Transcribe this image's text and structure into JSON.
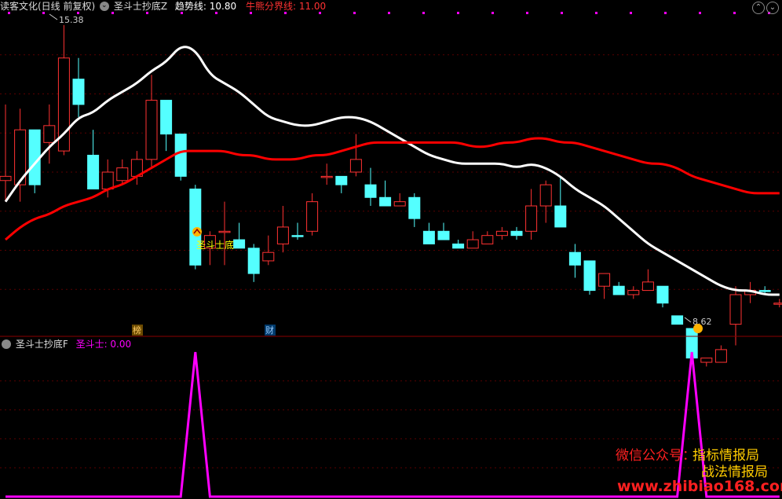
{
  "header": {
    "stock_name": "读客文化(日线 前复权)",
    "indicator_name": "圣斗士抄底Z",
    "trend_label": "趋势线: ",
    "trend_value": "10.80",
    "bull_bear_label": "牛熊分界线: ",
    "bull_bear_value": "11.00",
    "collapse_icon": "chevron-down-circle-icon"
  },
  "sub_header": {
    "indicator_name": "圣斗士抄底F",
    "value_label": "圣斗士: ",
    "value": "0.00"
  },
  "annotations": {
    "high_label": "15.38",
    "low_label": "8.62",
    "signal_label": "圣斗士底",
    "badge_bang": "榜",
    "badge_cai": "财"
  },
  "watermark": {
    "line1": "微信公众号：",
    "line1b": "指标情报局",
    "line2": "战法情报局",
    "line3": "www.zhibiao168.com"
  },
  "colors": {
    "up": "#ff3232",
    "down": "#54ffff",
    "trend": "#ffffff",
    "bullbear": "#ff0000",
    "signal": "#ff00ff",
    "label_yellow": "#ffff00"
  },
  "chart_data": {
    "type": "candlestick",
    "price_ylim": [
      8.2,
      15.6
    ],
    "candles": [
      {
        "o": 11.8,
        "h": 13.5,
        "l": 11.2,
        "c": 11.7,
        "d": "u"
      },
      {
        "o": 11.6,
        "h": 13.4,
        "l": 11.2,
        "c": 12.9,
        "d": "u"
      },
      {
        "o": 12.9,
        "h": 12.9,
        "l": 11.4,
        "c": 11.6,
        "d": "d"
      },
      {
        "o": 13.0,
        "h": 13.5,
        "l": 12.1,
        "c": 12.6,
        "d": "u"
      },
      {
        "o": 12.4,
        "h": 15.38,
        "l": 12.3,
        "c": 14.6,
        "d": "u"
      },
      {
        "o": 14.1,
        "h": 14.6,
        "l": 13.2,
        "c": 13.5,
        "d": "d"
      },
      {
        "o": 12.3,
        "h": 12.9,
        "l": 11.5,
        "c": 11.5,
        "d": "d"
      },
      {
        "o": 11.5,
        "h": 12.2,
        "l": 11.3,
        "c": 11.9,
        "d": "u"
      },
      {
        "o": 11.7,
        "h": 12.2,
        "l": 11.6,
        "c": 12.0,
        "d": "u"
      },
      {
        "o": 11.8,
        "h": 12.4,
        "l": 11.6,
        "c": 12.2,
        "d": "u"
      },
      {
        "o": 12.2,
        "h": 14.2,
        "l": 12.0,
        "c": 13.6,
        "d": "u"
      },
      {
        "o": 13.6,
        "h": 13.4,
        "l": 12.4,
        "c": 12.8,
        "d": "d"
      },
      {
        "o": 12.8,
        "h": 12.7,
        "l": 11.7,
        "c": 11.8,
        "d": "d"
      },
      {
        "o": 11.5,
        "h": 11.6,
        "l": 9.6,
        "c": 9.7,
        "d": "d"
      },
      {
        "o": 10.1,
        "h": 10.5,
        "l": 9.7,
        "c": 10.4,
        "d": "u"
      },
      {
        "o": 10.5,
        "h": 11.2,
        "l": 9.7,
        "c": 10.5,
        "d": "u"
      },
      {
        "o": 10.3,
        "h": 10.7,
        "l": 10.1,
        "c": 10.1,
        "d": "d"
      },
      {
        "o": 10.1,
        "h": 10.2,
        "l": 9.3,
        "c": 9.5,
        "d": "d"
      },
      {
        "o": 9.8,
        "h": 10.4,
        "l": 9.7,
        "c": 10.0,
        "d": "u"
      },
      {
        "o": 10.2,
        "h": 11.1,
        "l": 10.0,
        "c": 10.6,
        "d": "u"
      },
      {
        "o": 10.4,
        "h": 10.7,
        "l": 10.3,
        "c": 10.4,
        "d": "d"
      },
      {
        "o": 10.5,
        "h": 11.4,
        "l": 10.4,
        "c": 11.2,
        "d": "u"
      },
      {
        "o": 11.8,
        "h": 12.1,
        "l": 11.6,
        "c": 11.8,
        "d": "u"
      },
      {
        "o": 11.8,
        "h": 11.6,
        "l": 11.4,
        "c": 11.6,
        "d": "d"
      },
      {
        "o": 11.9,
        "h": 12.8,
        "l": 11.8,
        "c": 12.2,
        "d": "u"
      },
      {
        "o": 11.6,
        "h": 12.0,
        "l": 11.1,
        "c": 11.3,
        "d": "d"
      },
      {
        "o": 11.3,
        "h": 11.7,
        "l": 11.1,
        "c": 11.1,
        "d": "d"
      },
      {
        "o": 11.1,
        "h": 11.4,
        "l": 11.1,
        "c": 11.2,
        "d": "u"
      },
      {
        "o": 11.3,
        "h": 11.4,
        "l": 10.6,
        "c": 10.8,
        "d": "d"
      },
      {
        "o": 10.5,
        "h": 10.7,
        "l": 10.2,
        "c": 10.2,
        "d": "d"
      },
      {
        "o": 10.5,
        "h": 10.7,
        "l": 10.3,
        "c": 10.3,
        "d": "d"
      },
      {
        "o": 10.2,
        "h": 10.3,
        "l": 10.1,
        "c": 10.1,
        "d": "d"
      },
      {
        "o": 10.1,
        "h": 10.5,
        "l": 10.1,
        "c": 10.3,
        "d": "u"
      },
      {
        "o": 10.2,
        "h": 10.5,
        "l": 10.2,
        "c": 10.4,
        "d": "u"
      },
      {
        "o": 10.4,
        "h": 10.6,
        "l": 10.3,
        "c": 10.5,
        "d": "u"
      },
      {
        "o": 10.5,
        "h": 10.6,
        "l": 10.3,
        "c": 10.4,
        "d": "d"
      },
      {
        "o": 10.5,
        "h": 11.5,
        "l": 10.3,
        "c": 11.1,
        "d": "u"
      },
      {
        "o": 11.1,
        "h": 11.7,
        "l": 10.7,
        "c": 11.6,
        "d": "u"
      },
      {
        "o": 11.1,
        "h": 11.8,
        "l": 10.6,
        "c": 10.6,
        "d": "d"
      },
      {
        "o": 10.0,
        "h": 10.2,
        "l": 9.4,
        "c": 9.7,
        "d": "d"
      },
      {
        "o": 9.8,
        "h": 9.8,
        "l": 9.0,
        "c": 9.1,
        "d": "d"
      },
      {
        "o": 9.2,
        "h": 9.5,
        "l": 8.9,
        "c": 9.5,
        "d": "u"
      },
      {
        "o": 9.2,
        "h": 9.3,
        "l": 9.0,
        "c": 9.0,
        "d": "d"
      },
      {
        "o": 9.0,
        "h": 9.2,
        "l": 8.9,
        "c": 9.1,
        "d": "u"
      },
      {
        "o": 9.3,
        "h": 9.6,
        "l": 9.1,
        "c": 9.1,
        "d": "u"
      },
      {
        "o": 9.2,
        "h": 9.2,
        "l": 8.7,
        "c": 8.8,
        "d": "d"
      },
      {
        "o": 8.5,
        "h": 8.5,
        "l": 8.3,
        "c": 8.3,
        "d": "d"
      },
      {
        "o": 8.2,
        "h": 8.2,
        "l": 7.4,
        "c": 7.5,
        "d": "d"
      },
      {
        "o": 7.4,
        "h": 7.5,
        "l": 7.3,
        "c": 7.5,
        "d": "u"
      },
      {
        "o": 7.4,
        "h": 7.8,
        "l": 7.4,
        "c": 7.7,
        "d": "u"
      },
      {
        "o": 8.3,
        "h": 9.2,
        "l": 7.8,
        "c": 9.0,
        "d": "u"
      },
      {
        "o": 9.0,
        "h": 9.3,
        "l": 8.8,
        "c": 9.1,
        "d": "u"
      },
      {
        "o": 9.1,
        "h": 9.2,
        "l": 9.0,
        "c": 9.1,
        "d": "d"
      },
      {
        "o": 8.8,
        "h": 8.9,
        "l": 8.7,
        "c": 8.8,
        "d": "u"
      }
    ],
    "trend_line": [
      11.2,
      11.7,
      12.1,
      12.5,
      12.8,
      13.2,
      13.3,
      13.6,
      13.8,
      14.0,
      14.3,
      14.5,
      14.9,
      14.8,
      14.2,
      14.0,
      13.8,
      13.5,
      13.2,
      13.1,
      13.0,
      13.0,
      13.1,
      13.2,
      13.2,
      13.1,
      12.9,
      12.7,
      12.5,
      12.3,
      12.2,
      12.1,
      12.1,
      12.1,
      12.1,
      12.0,
      12.1,
      12.0,
      11.8,
      11.5,
      11.3,
      11.1,
      10.8,
      10.5,
      10.2,
      10.0,
      9.8,
      9.6,
      9.4,
      9.2,
      9.1,
      9.1,
      9.0,
      9.0
    ],
    "bullbear_line": [
      10.3,
      10.6,
      10.8,
      10.9,
      11.1,
      11.2,
      11.3,
      11.5,
      11.6,
      11.8,
      12.0,
      12.2,
      12.4,
      12.4,
      12.4,
      12.4,
      12.3,
      12.3,
      12.2,
      12.2,
      12.2,
      12.3,
      12.3,
      12.4,
      12.5,
      12.6,
      12.6,
      12.6,
      12.6,
      12.6,
      12.6,
      12.6,
      12.5,
      12.5,
      12.6,
      12.6,
      12.7,
      12.7,
      12.6,
      12.6,
      12.5,
      12.4,
      12.3,
      12.2,
      12.1,
      12.1,
      12.0,
      11.8,
      11.7,
      11.6,
      11.5,
      11.4,
      11.4,
      11.4
    ],
    "signal_series": [
      0,
      0,
      0,
      0,
      0,
      0,
      0,
      0,
      0,
      0,
      0,
      0,
      0,
      1,
      0,
      0,
      0,
      0,
      0,
      0,
      0,
      0,
      0,
      0,
      0,
      0,
      0,
      0,
      0,
      0,
      0,
      0,
      0,
      0,
      0,
      0,
      0,
      0,
      0,
      0,
      0,
      0,
      0,
      0,
      0,
      0,
      0,
      1,
      0,
      0,
      0,
      0,
      0,
      0
    ],
    "signal_ylim": [
      0,
      1
    ]
  }
}
